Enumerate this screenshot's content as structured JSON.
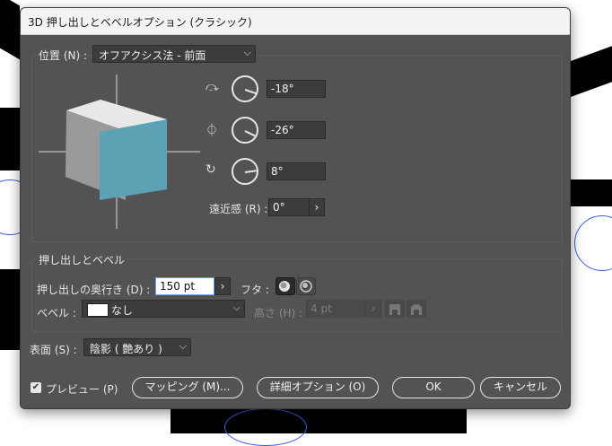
{
  "window": {
    "title": "3D 押し出しとベベルオプション (クラシック)"
  },
  "position": {
    "label": "位置 (N) :",
    "preset": "オフアクシス法 - 前面",
    "rotation_x": "-18°",
    "rotation_y": "-26°",
    "rotation_z": "8°",
    "perspective_label": "遠近感 (R) :",
    "perspective_value": "0°"
  },
  "extrude": {
    "section_label": "押し出しとベベル",
    "depth_label": "押し出しの奥行き (D) :",
    "depth_value": "150 pt",
    "cap_label": "フタ :",
    "bevel_label": "ベベル :",
    "bevel_value": "なし",
    "height_label": "高さ (H) :",
    "height_value": "4 pt"
  },
  "surface": {
    "label": "表面 (S) :",
    "value": "陰影 ( 艶あり )"
  },
  "footer": {
    "preview_label": "プレビュー (P)",
    "preview_checked": true,
    "mapping_button": "マッピング (M)...",
    "more_options_button": "詳細オプション (O)",
    "ok_button": "OK",
    "cancel_button": "キャンセル"
  },
  "colors": {
    "cube_front": "#5aa2b4",
    "cube_side": "#9a9a9a",
    "cube_top": "#e8e8e8"
  }
}
